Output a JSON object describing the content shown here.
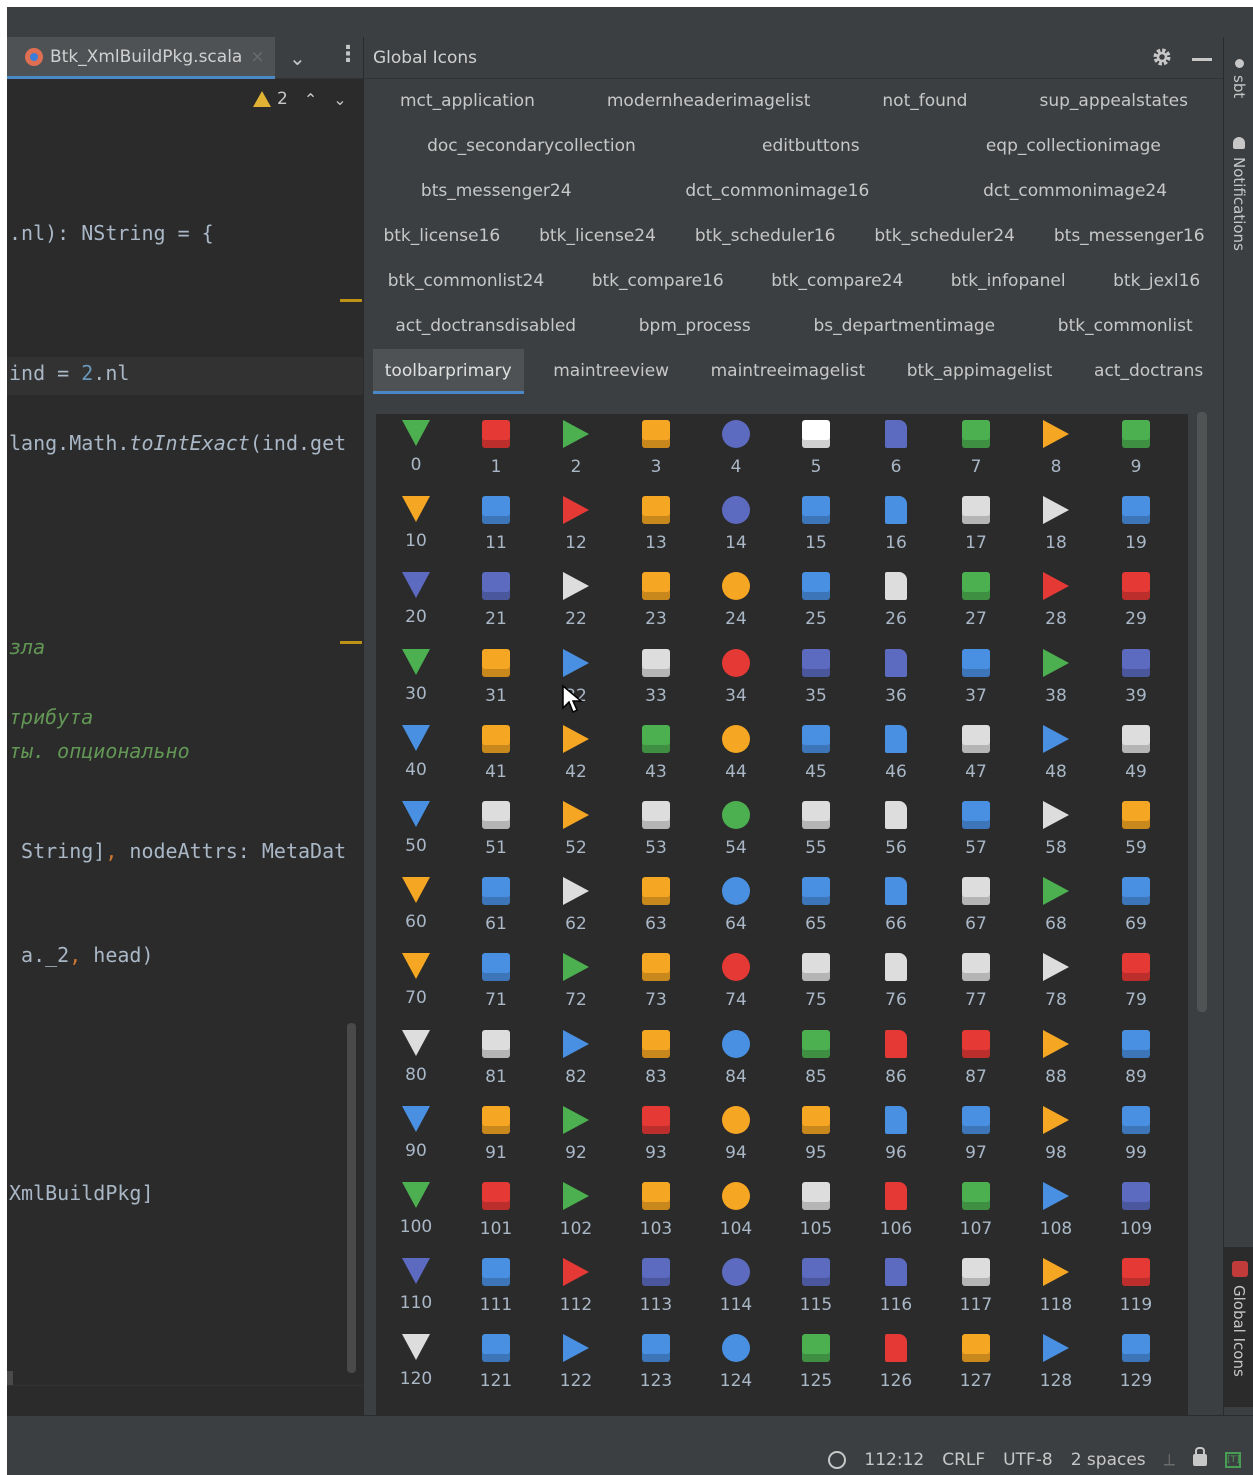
{
  "editor": {
    "file_tab_label": "Btk_XmlBuildPkg.scala",
    "tab_close": "×",
    "tab_dropdown": "⌄",
    "tab_menu": "⋮",
    "warning_count": "2",
    "lines": {
      "l1": ".nl): NString = {",
      "l2": "ind = ",
      "l2_num": "2",
      "l2_end": ".nl",
      "l3_a": "lang.Math.",
      "l3_b": "toIntExact",
      "l3_c": "(ind.get",
      "l4": "зла",
      "l5": "трибута",
      "l6": "ты. опционально",
      "l7_a": " String]",
      "l7_comma": ",",
      "l7_b": " nodeAttrs: MetaDat",
      "l8_a": " a._2",
      "l8_comma": ",",
      "l8_b": " head)",
      "l9": "XmlBuildPkg]"
    }
  },
  "tool_window": {
    "title": "Global Icons",
    "tab_rows": [
      [
        "mct_application",
        "modernheaderimagelist",
        "not_found",
        "sup_appealstates"
      ],
      [
        "doc_secondarycollection",
        "editbuttons",
        "eqp_collectionimage"
      ],
      [
        "bts_messenger24",
        "dct_commonimage16",
        "dct_commonimage24"
      ],
      [
        "btk_license16",
        "btk_license24",
        "btk_scheduler16",
        "btk_scheduler24",
        "bts_messenger16"
      ],
      [
        "btk_commonlist24",
        "btk_compare16",
        "btk_compare24",
        "btk_infopanel",
        "btk_jexl16"
      ],
      [
        "act_doctransdisabled",
        "bpm_process",
        "bs_departmentimage",
        "btk_commonlist"
      ],
      [
        "toolbarprimary",
        "maintreeview",
        "maintreeimagelist",
        "btk_appimagelist",
        "act_doctrans"
      ]
    ],
    "selected_tab": "toolbarprimary",
    "grid_numbers": [
      "0",
      "1",
      "2",
      "3",
      "4",
      "5",
      "6",
      "7",
      "8",
      "9",
      "10",
      "11",
      "12",
      "13",
      "14",
      "15",
      "16",
      "17",
      "18",
      "19",
      "20",
      "21",
      "22",
      "23",
      "24",
      "25",
      "26",
      "27",
      "28",
      "29",
      "30",
      "31",
      "32",
      "33",
      "34",
      "35",
      "36",
      "37",
      "38",
      "39",
      "40",
      "41",
      "42",
      "43",
      "44",
      "45",
      "46",
      "47",
      "48",
      "49",
      "50",
      "51",
      "52",
      "53",
      "54",
      "55",
      "56",
      "57",
      "58",
      "59",
      "60",
      "61",
      "62",
      "63",
      "64",
      "65",
      "66",
      "67",
      "68",
      "69",
      "70",
      "71",
      "72",
      "73",
      "74",
      "75",
      "76",
      "77",
      "78",
      "79",
      "80",
      "81",
      "82",
      "83",
      "84",
      "85",
      "86",
      "87",
      "88",
      "89",
      "90",
      "91",
      "92",
      "93",
      "94",
      "95",
      "96",
      "97",
      "98",
      "99",
      "100",
      "101",
      "102",
      "103",
      "104",
      "105",
      "106",
      "107",
      "108",
      "109",
      "110",
      "111",
      "112",
      "113",
      "114",
      "115",
      "116",
      "117",
      "118",
      "119",
      "120",
      "121",
      "122",
      "123",
      "124",
      "125",
      "126",
      "127",
      "128",
      "129"
    ],
    "icon_colors": [
      "#4caf50",
      "#e53935",
      "#4caf50",
      "#f5a623",
      "#5c6bc0",
      "#ffffff",
      "#5c6bc0",
      "#4caf50",
      "#f5a623",
      "#4caf50",
      "#f5a623",
      "#4a90e2",
      "#e53935",
      "#f5a623",
      "#5c6bc0",
      "#4a90e2",
      "#4a90e2",
      "#dddddd",
      "#dddddd",
      "#4a90e2",
      "#5c6bc0",
      "#5c6bc0",
      "#dddddd",
      "#f5a623",
      "#f5a623",
      "#4a90e2",
      "#dddddd",
      "#4caf50",
      "#e53935",
      "#e53935",
      "#4caf50",
      "#f5a623",
      "#4a90e2",
      "#dddddd",
      "#e53935",
      "#5c6bc0",
      "#5c6bc0",
      "#4a90e2",
      "#4caf50",
      "#5c6bc0",
      "#4a90e2",
      "#f5a623",
      "#f5a623",
      "#4caf50",
      "#f5a623",
      "#4a90e2",
      "#4a90e2",
      "#dddddd",
      "#4a90e2",
      "#dddddd",
      "#4a90e2",
      "#dddddd",
      "#f5a623",
      "#dddddd",
      "#4caf50",
      "#dddddd",
      "#dddddd",
      "#4a90e2",
      "#dddddd",
      "#f5a623",
      "#f5a623",
      "#4a90e2",
      "#dddddd",
      "#f5a623",
      "#4a90e2",
      "#4a90e2",
      "#4a90e2",
      "#dddddd",
      "#4caf50",
      "#4a90e2",
      "#f5a623",
      "#4a90e2",
      "#4caf50",
      "#f5a623",
      "#e53935",
      "#dddddd",
      "#dddddd",
      "#dddddd",
      "#dddddd",
      "#e53935",
      "#dddddd",
      "#dddddd",
      "#4a90e2",
      "#f5a623",
      "#4a90e2",
      "#4caf50",
      "#e53935",
      "#e53935",
      "#f5a623",
      "#4a90e2",
      "#4a90e2",
      "#f5a623",
      "#4caf50",
      "#e53935",
      "#f5a623",
      "#f5a623",
      "#4a90e2",
      "#4a90e2",
      "#f5a623",
      "#4a90e2",
      "#4caf50",
      "#e53935",
      "#4caf50",
      "#f5a623",
      "#f5a623",
      "#dddddd",
      "#e53935",
      "#4caf50",
      "#4a90e2",
      "#5c6bc0",
      "#5c6bc0",
      "#4a90e2",
      "#e53935",
      "#5c6bc0",
      "#5c6bc0",
      "#5c6bc0",
      "#5c6bc0",
      "#dddddd",
      "#f5a623",
      "#e53935",
      "#dddddd",
      "#4a90e2",
      "#4a90e2",
      "#4a90e2",
      "#4a90e2",
      "#4caf50",
      "#e53935",
      "#f5a623",
      "#4a90e2",
      "#4a90e2"
    ]
  },
  "right_strip": {
    "sbt": "sbt",
    "notifications": "Notifications",
    "global_icons": "Global Icons"
  },
  "status_bar": {
    "position": "112:12",
    "line_sep": "CRLF",
    "encoding": "UTF-8",
    "indent": "2 spaces",
    "badge": "[T]"
  }
}
